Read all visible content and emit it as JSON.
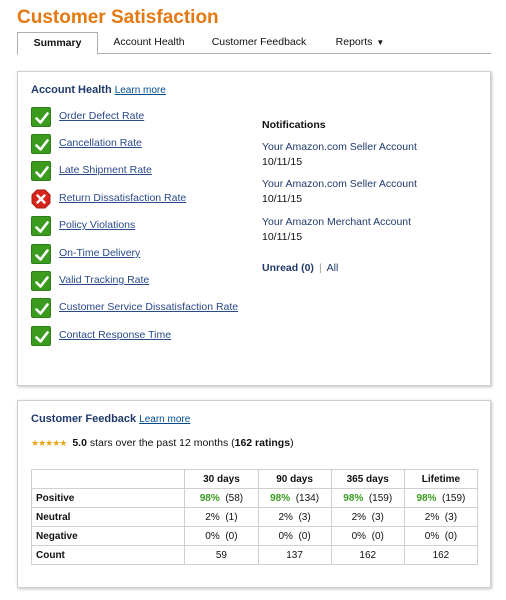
{
  "page_title": "Customer Satisfaction",
  "tabs": [
    {
      "label": "Summary",
      "active": true
    },
    {
      "label": "Account Health"
    },
    {
      "label": "Customer Feedback"
    },
    {
      "label": "Reports",
      "caret": "▼"
    }
  ],
  "account_health": {
    "heading": "Account Health",
    "learn_more": "Learn more",
    "metrics": [
      {
        "label": "Order Defect Rate",
        "status": "ok"
      },
      {
        "label": "Cancellation Rate",
        "status": "ok"
      },
      {
        "label": "Late Shipment Rate",
        "status": "ok"
      },
      {
        "label": "Return Dissatisfaction Rate",
        "status": "bad"
      },
      {
        "label": "Policy Violations",
        "status": "ok"
      },
      {
        "label": "On-Time Delivery",
        "status": "ok"
      },
      {
        "label": "Valid Tracking Rate",
        "status": "ok"
      },
      {
        "label": "Customer Service Dissatisfaction Rate",
        "status": "ok"
      },
      {
        "label": "Contact Response Time",
        "status": "ok"
      }
    ],
    "notifications": {
      "title": "Notifications",
      "items": [
        {
          "sender": "Your Amazon.com Seller Account",
          "date": "10/11/15"
        },
        {
          "sender": "Your Amazon.com Seller Account",
          "date": "10/11/15"
        },
        {
          "sender": "Your Amazon Merchant Account",
          "date": "10/11/15"
        }
      ],
      "unread_label": "Unread (0)",
      "separator": "|",
      "all_label": "All"
    },
    "colors": {
      "ok": "#3a9b1f",
      "bad": "#d6261c"
    }
  },
  "customer_feedback": {
    "heading": "Customer Feedback",
    "learn_more": "Learn more",
    "stars_glyph": "★★★★★",
    "score": "5.0",
    "summary_mid": "stars over the past 12 months (",
    "ratings_count": "162 ratings",
    "summary_end": ")",
    "columns": [
      "",
      "30 days",
      "90 days",
      "365 days",
      "Lifetime"
    ],
    "rows": [
      {
        "label": "Positive",
        "cells": [
          [
            "98%",
            "(58)"
          ],
          [
            "98%",
            "(134)"
          ],
          [
            "98%",
            "(159)"
          ],
          [
            "98%",
            "(159)"
          ]
        ],
        "highlight": true
      },
      {
        "label": "Neutral",
        "cells": [
          [
            "2%",
            "(1)"
          ],
          [
            "2%",
            "(3)"
          ],
          [
            "2%",
            "(3)"
          ],
          [
            "2%",
            "(3)"
          ]
        ]
      },
      {
        "label": "Negative",
        "cells": [
          [
            "0%",
            "(0)"
          ],
          [
            "0%",
            "(0)"
          ],
          [
            "0%",
            "(0)"
          ],
          [
            "0%",
            "(0)"
          ]
        ]
      },
      {
        "label": "Count",
        "cells": [
          [
            "59"
          ],
          [
            "137"
          ],
          [
            "162"
          ],
          [
            "162"
          ]
        ]
      }
    ]
  }
}
